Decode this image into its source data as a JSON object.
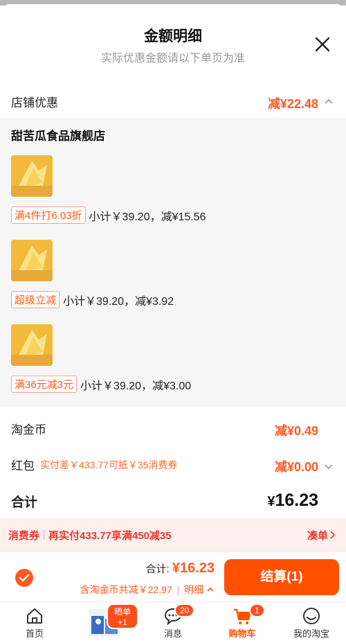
{
  "header": {
    "title": "金额明细",
    "subtitle": "实际优惠金额请以下单页为准"
  },
  "store_discount": {
    "label": "店铺优惠",
    "value": "减¥22.48"
  },
  "store": {
    "name": "甜苦瓜食品旗舰店",
    "items": [
      {
        "tag": "满4件打6.03折",
        "text": "小计￥39.20，减¥15.56"
      },
      {
        "tag": "超级立减",
        "text": "小计￥39.20，减¥3.92"
      },
      {
        "tag": "满36元减3元",
        "text": "小计￥39.20，减¥3.00"
      }
    ]
  },
  "coins": {
    "label": "淘金币",
    "value": "减¥0.49"
  },
  "redpacket": {
    "label": "红包",
    "hint": "实付差￥433.77可抵￥35消费券",
    "value": "减¥0.00"
  },
  "total": {
    "label": "合计",
    "currency": "¥",
    "value": "16.23"
  },
  "coupon_bar": {
    "left": "消费券",
    "middle": "再实付433.77享满450减35",
    "action": "凑单"
  },
  "checkout": {
    "sum_label": "合计:",
    "sum_value": "¥16.23",
    "sub": "含淘金币共减￥22.97",
    "detail": "明细",
    "button": "结算(1)"
  },
  "tabs": [
    {
      "label": "首页",
      "icon": "home-icon"
    },
    {
      "label": "",
      "icon": "product-image",
      "badge": "晒单+1"
    },
    {
      "label": "消息",
      "icon": "message-icon",
      "badge": "20"
    },
    {
      "label": "购物车",
      "icon": "cart-icon",
      "badge": "1",
      "active": true
    },
    {
      "label": "我的淘宝",
      "icon": "profile-icon"
    }
  ],
  "colors": {
    "accent": "#ff5000",
    "discount": "#ff5a1f",
    "coupon_text": "#e63a2e",
    "coupon_bg": "#fff0ee"
  }
}
